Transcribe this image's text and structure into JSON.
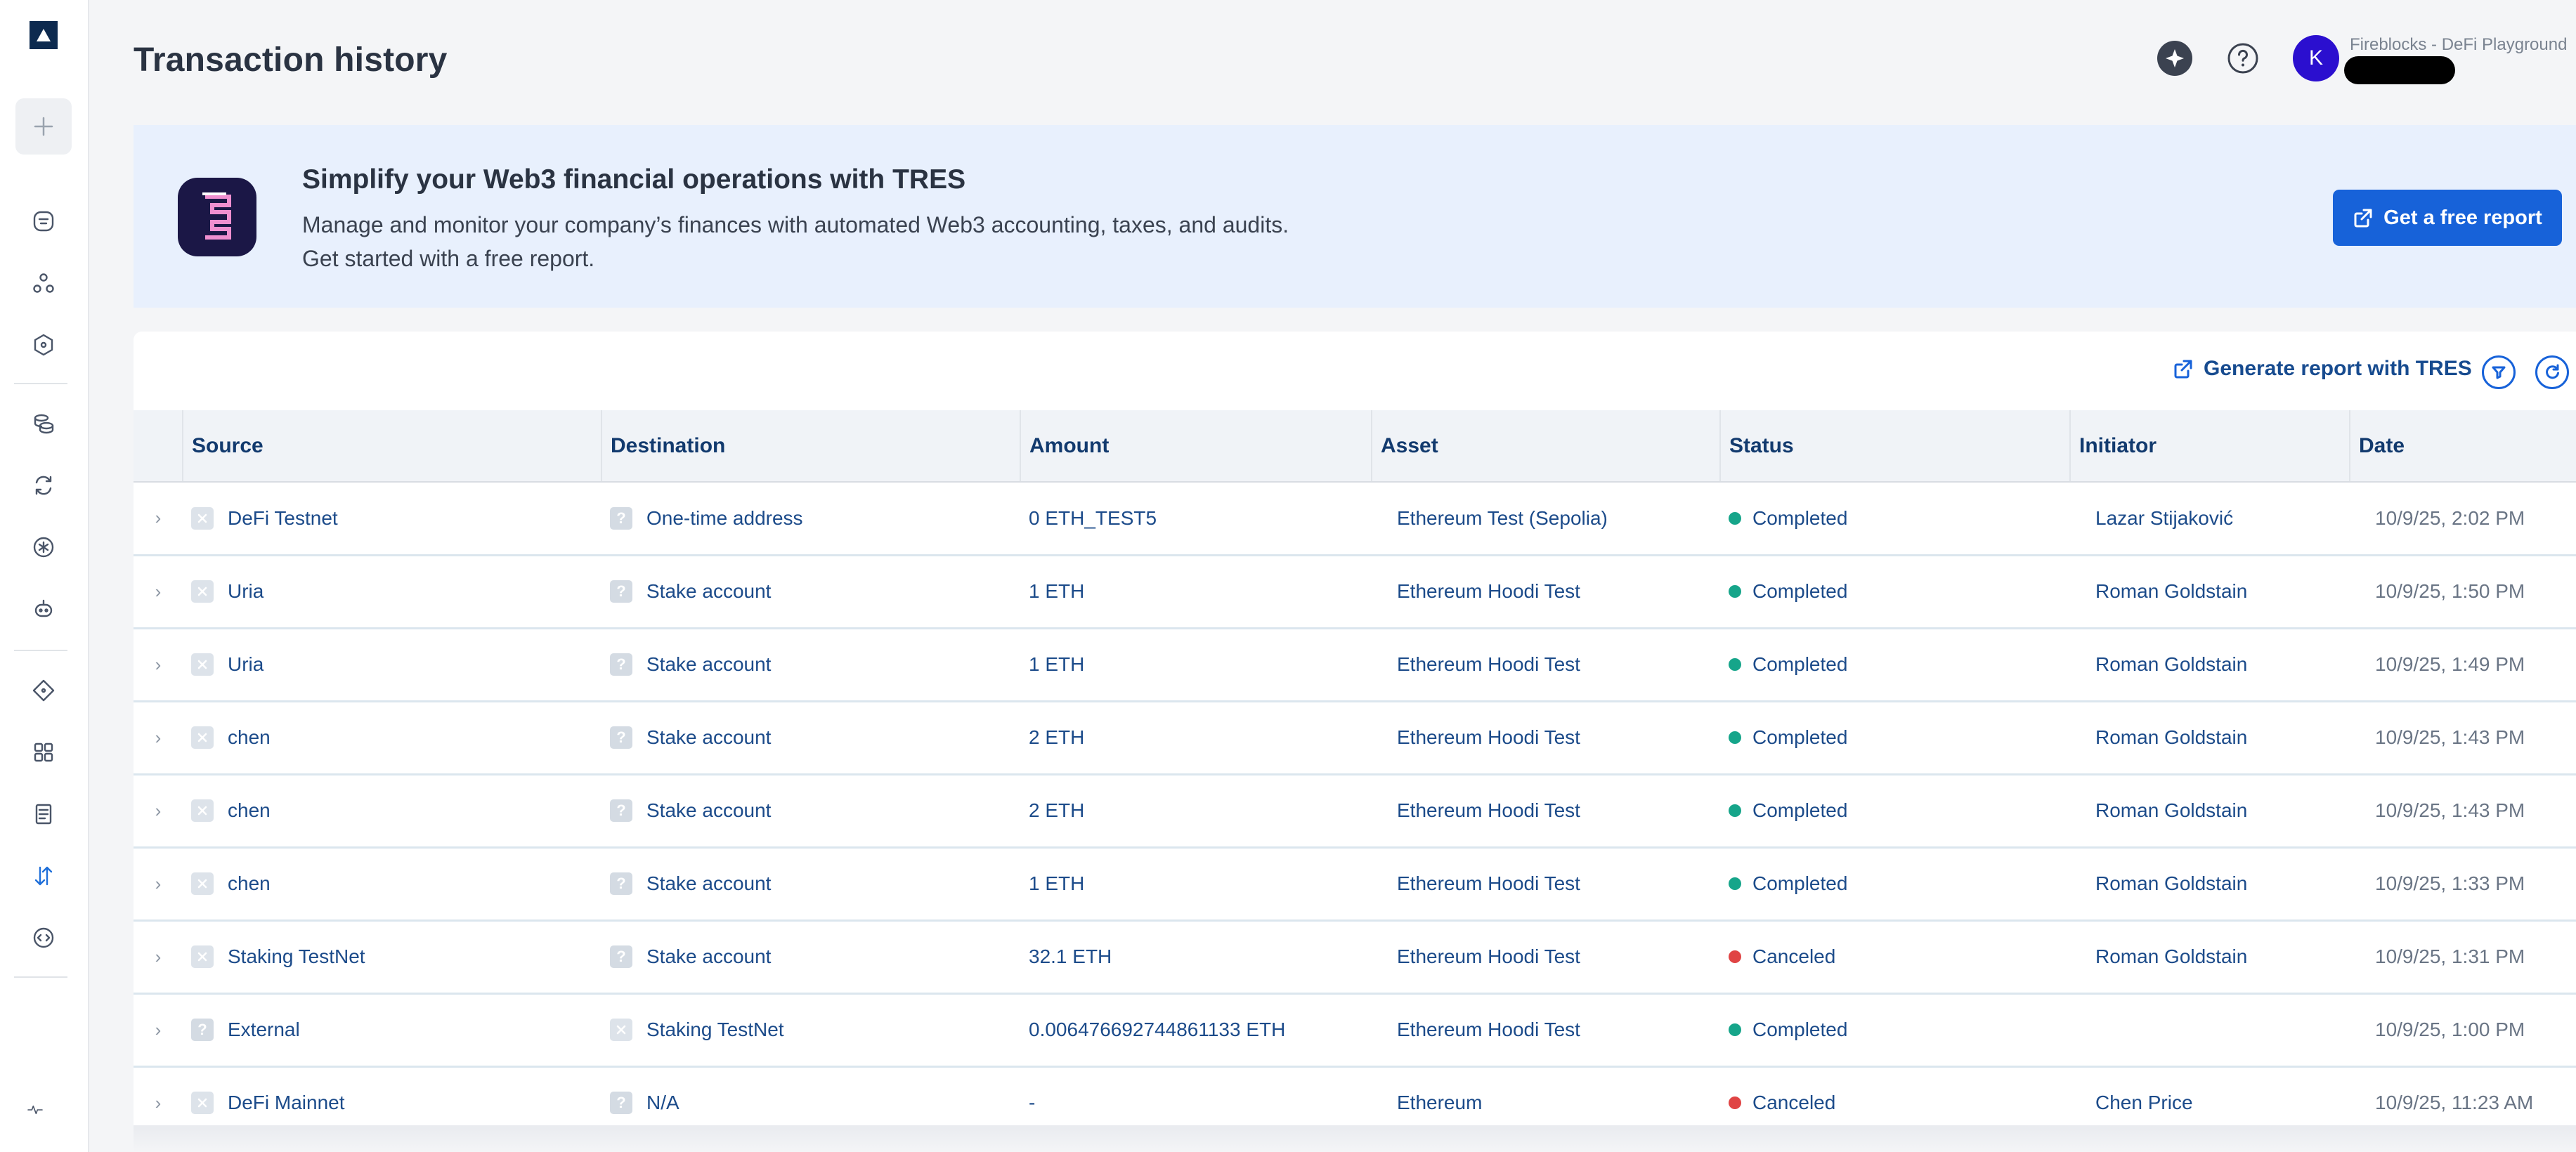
{
  "header": {
    "title": "Transaction history",
    "avatar_initial": "K",
    "workspace": "Fireblocks - DeFi Playground"
  },
  "banner": {
    "title": "Simplify your Web3 financial operations with TRES",
    "line1": "Manage and monitor your company’s finances with automated Web3 accounting, taxes, and audits.",
    "line2": "Get started with a free report.",
    "cta": "Get a free report"
  },
  "toolbar": {
    "generate_report": "Generate report with TRES"
  },
  "table": {
    "columns": [
      "Source",
      "Destination",
      "Amount",
      "Asset",
      "Status",
      "Initiator",
      "Date"
    ],
    "rows": [
      {
        "source": "DeFi Testnet",
        "source_icon": "vault-icon",
        "destination": "One-time address",
        "destination_icon": "unknown-icon",
        "amount": "0 ETH_TEST5",
        "asset": "Ethereum Test (Sepolia)",
        "status": "Completed",
        "initiator": "Lazar Stijaković",
        "date": "10/9/25, 2:02 PM"
      },
      {
        "source": "Uria",
        "source_icon": "vault-icon",
        "destination": "Stake account",
        "destination_icon": "unknown-icon",
        "amount": "1 ETH",
        "asset": "Ethereum Hoodi Test",
        "status": "Completed",
        "initiator": "Roman Goldstain",
        "date": "10/9/25, 1:50 PM"
      },
      {
        "source": "Uria",
        "source_icon": "vault-icon",
        "destination": "Stake account",
        "destination_icon": "unknown-icon",
        "amount": "1 ETH",
        "asset": "Ethereum Hoodi Test",
        "status": "Completed",
        "initiator": "Roman Goldstain",
        "date": "10/9/25, 1:49 PM"
      },
      {
        "source": "chen",
        "source_icon": "vault-icon",
        "destination": "Stake account",
        "destination_icon": "unknown-icon",
        "amount": "2 ETH",
        "asset": "Ethereum Hoodi Test",
        "status": "Completed",
        "initiator": "Roman Goldstain",
        "date": "10/9/25, 1:43 PM"
      },
      {
        "source": "chen",
        "source_icon": "vault-icon",
        "destination": "Stake account",
        "destination_icon": "unknown-icon",
        "amount": "2 ETH",
        "asset": "Ethereum Hoodi Test",
        "status": "Completed",
        "initiator": "Roman Goldstain",
        "date": "10/9/25, 1:43 PM"
      },
      {
        "source": "chen",
        "source_icon": "vault-icon",
        "destination": "Stake account",
        "destination_icon": "unknown-icon",
        "amount": "1 ETH",
        "asset": "Ethereum Hoodi Test",
        "status": "Completed",
        "initiator": "Roman Goldstain",
        "date": "10/9/25, 1:33 PM"
      },
      {
        "source": "Staking TestNet",
        "source_icon": "vault-icon",
        "destination": "Stake account",
        "destination_icon": "unknown-icon",
        "amount": "32.1 ETH",
        "asset": "Ethereum Hoodi Test",
        "status": "Canceled",
        "initiator": "Roman Goldstain",
        "date": "10/9/25, 1:31 PM"
      },
      {
        "source": "External",
        "source_icon": "unknown-icon",
        "destination": "Staking TestNet",
        "destination_icon": "vault-icon",
        "amount": "0.006476692744861133 ETH",
        "asset": "Ethereum Hoodi Test",
        "status": "Completed",
        "initiator": "",
        "date": "10/9/25, 1:00 PM"
      },
      {
        "source": "DeFi Mainnet",
        "source_icon": "vault-icon",
        "destination": "N/A",
        "destination_icon": "unknown-icon",
        "amount": "-",
        "asset": "Ethereum",
        "status": "Canceled",
        "initiator": "Chen Price",
        "date": "10/9/25, 11:23 AM"
      }
    ]
  },
  "colors": {
    "accent": "#1762d9",
    "completed": "#16a58a",
    "canceled": "#e04444",
    "avatar": "#2b0fcf"
  }
}
